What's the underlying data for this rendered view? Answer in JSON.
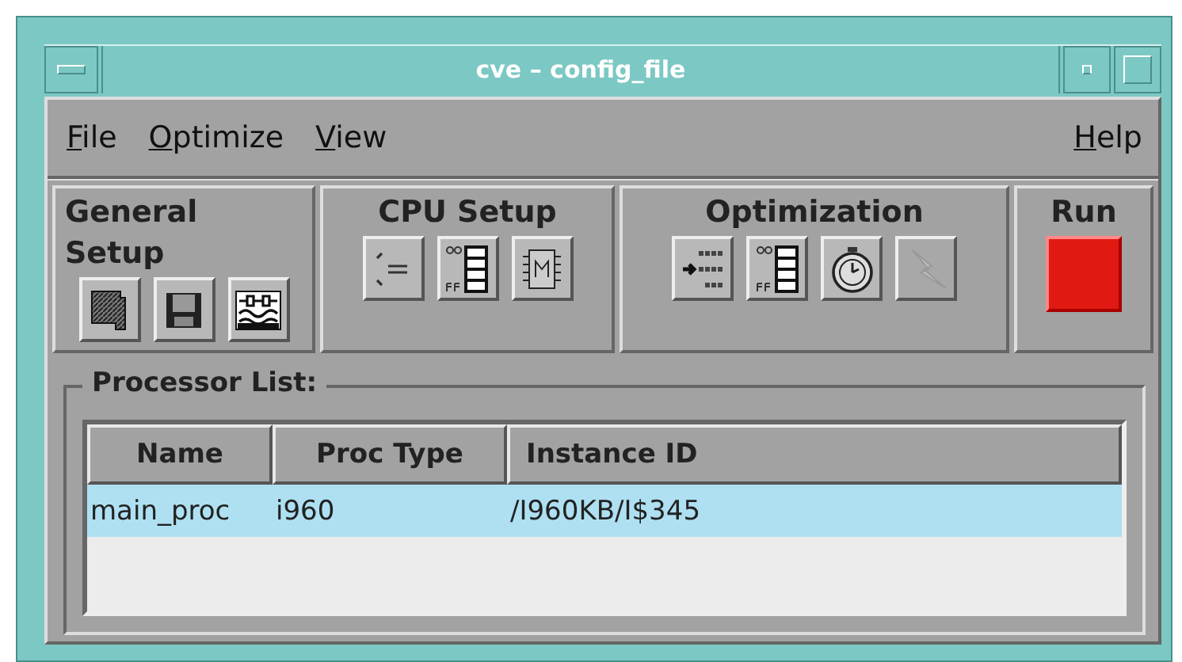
{
  "window": {
    "title": "cve – config_file"
  },
  "menu": {
    "left": [
      {
        "label": "File"
      },
      {
        "label": "Optimize"
      },
      {
        "label": "View"
      }
    ],
    "right": [
      {
        "label": "Help"
      }
    ]
  },
  "toolbar": [
    {
      "title": "General Setup",
      "tools": [
        {
          "kind": "folder",
          "disabled": false
        },
        {
          "kind": "disk",
          "disabled": false
        },
        {
          "kind": "signal",
          "disabled": false
        }
      ]
    },
    {
      "title": "CPU Setup",
      "tools": [
        {
          "kind": "braces",
          "disabled": false
        },
        {
          "kind": "registers",
          "disabled": false
        },
        {
          "kind": "chip",
          "disabled": false
        }
      ]
    },
    {
      "title": "Optimization",
      "tools": [
        {
          "kind": "instructions",
          "disabled": false
        },
        {
          "kind": "registers",
          "disabled": false
        },
        {
          "kind": "stopwatch",
          "disabled": false
        },
        {
          "kind": "lightning",
          "disabled": true
        }
      ]
    },
    {
      "title": "Run",
      "tools": [
        {
          "kind": "run",
          "disabled": false
        }
      ]
    }
  ],
  "processor_list": {
    "title": "Processor List:",
    "columns": [
      "Name",
      "Proc Type",
      "Instance ID"
    ],
    "rows": [
      {
        "cells": [
          "main_proc",
          "i960",
          "/I960KB/I$345"
        ],
        "selected": true
      }
    ]
  }
}
